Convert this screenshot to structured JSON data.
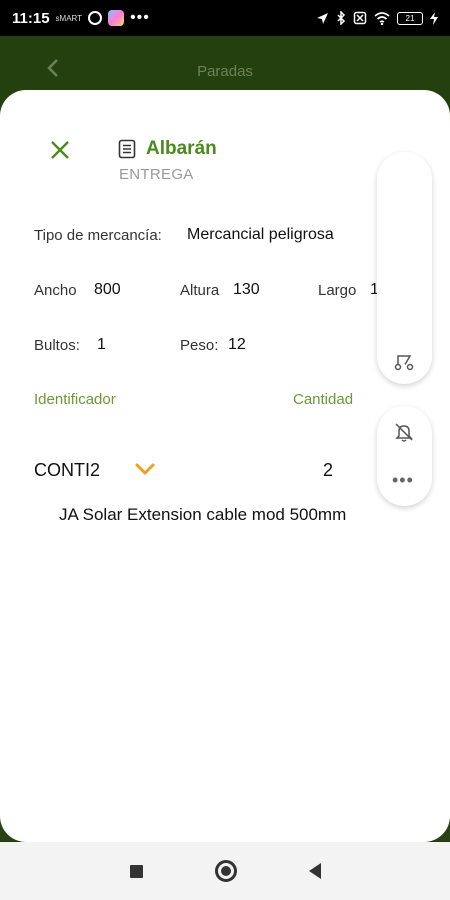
{
  "status_bar": {
    "time": "11:15",
    "left_chip": "sMART",
    "battery": "21"
  },
  "app_bar": {
    "title": "Paradas"
  },
  "header": {
    "title": "Albarán",
    "subtitle": "ENTREGA"
  },
  "details": {
    "merchandise_type_label": "Tipo de mercancía:",
    "merchandise_type_value": "Mercancial peligrosa",
    "width_label": "Ancho",
    "width_value": "800",
    "height_label": "Altura",
    "height_value": "130",
    "length_label": "Largo",
    "length_value": "1",
    "packages_label": "Bultos:",
    "packages_value": "1",
    "weight_label": "Peso:",
    "weight_value": "12"
  },
  "table": {
    "col_identifier": "Identificador",
    "col_quantity": "Cantidad",
    "rows": [
      {
        "code": "CONTI2",
        "quantity": "2",
        "description": "JA Solar Extension cable mod 500mm"
      }
    ]
  },
  "colors": {
    "primary_green": "#4b8a1c",
    "label_green": "#6b9a32",
    "accent_orange": "#f0a020",
    "app_bar_bg": "#25400f"
  },
  "icons": {
    "back": "chevron-left-icon",
    "close": "close-icon",
    "document": "document-list-icon",
    "expand": "chevron-down-icon",
    "fab_1": "route-icon",
    "fab_2": "bell-icon",
    "fab_more": "more-horizontal-icon"
  }
}
